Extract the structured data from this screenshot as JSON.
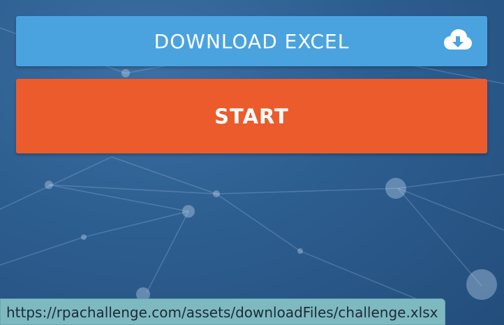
{
  "buttons": {
    "download_label": "DOWNLOAD EXCEL",
    "download_icon": "cloud-download-icon",
    "start_label": "START"
  },
  "status_bar": {
    "url": "https://rpachallenge.com/assets/downloadFiles/challenge.xlsx"
  },
  "colors": {
    "download_button": "#4aa3df",
    "start_button": "#eb5b2b",
    "background": "#2d5e90",
    "status_bar": "#7eb9c0"
  }
}
